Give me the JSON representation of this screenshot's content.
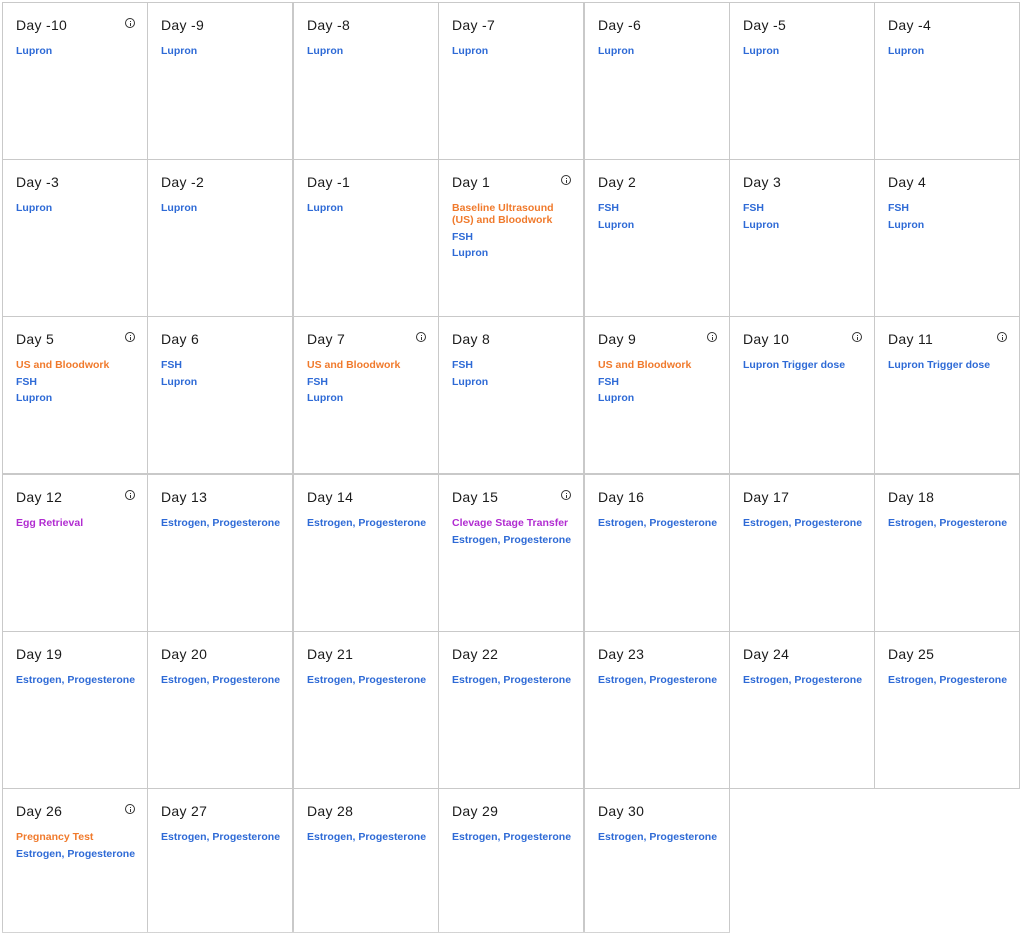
{
  "days": [
    {
      "label": "Day -10",
      "info": true,
      "events": [
        {
          "text": "Lupron",
          "color": "blue"
        }
      ]
    },
    {
      "label": "Day -9",
      "info": false,
      "events": [
        {
          "text": "Lupron",
          "color": "blue"
        }
      ]
    },
    {
      "label": "Day -8",
      "info": false,
      "events": [
        {
          "text": "Lupron",
          "color": "blue"
        }
      ]
    },
    {
      "label": "Day -7",
      "info": false,
      "events": [
        {
          "text": "Lupron",
          "color": "blue"
        }
      ]
    },
    {
      "label": "Day -6",
      "info": false,
      "events": [
        {
          "text": "Lupron",
          "color": "blue"
        }
      ]
    },
    {
      "label": "Day -5",
      "info": false,
      "events": [
        {
          "text": "Lupron",
          "color": "blue"
        }
      ]
    },
    {
      "label": "Day -4",
      "info": false,
      "events": [
        {
          "text": "Lupron",
          "color": "blue"
        }
      ]
    },
    {
      "label": "Day -3",
      "info": false,
      "events": [
        {
          "text": "Lupron",
          "color": "blue"
        }
      ]
    },
    {
      "label": "Day -2",
      "info": false,
      "events": [
        {
          "text": "Lupron",
          "color": "blue"
        }
      ]
    },
    {
      "label": "Day -1",
      "info": false,
      "events": [
        {
          "text": "Lupron",
          "color": "blue"
        }
      ]
    },
    {
      "label": "Day 1",
      "info": true,
      "events": [
        {
          "text": "Baseline Ultrasound (US) and Bloodwork",
          "color": "orange"
        },
        {
          "text": "FSH",
          "color": "blue"
        },
        {
          "text": "Lupron",
          "color": "blue"
        }
      ]
    },
    {
      "label": "Day 2",
      "info": false,
      "events": [
        {
          "text": "FSH",
          "color": "blue"
        },
        {
          "text": "Lupron",
          "color": "blue"
        }
      ]
    },
    {
      "label": "Day 3",
      "info": false,
      "events": [
        {
          "text": "FSH",
          "color": "blue"
        },
        {
          "text": "Lupron",
          "color": "blue"
        }
      ]
    },
    {
      "label": "Day 4",
      "info": false,
      "events": [
        {
          "text": "FSH",
          "color": "blue"
        },
        {
          "text": "Lupron",
          "color": "blue"
        }
      ]
    },
    {
      "label": "Day 5",
      "info": true,
      "events": [
        {
          "text": "US and Bloodwork",
          "color": "orange"
        },
        {
          "text": "FSH",
          "color": "blue"
        },
        {
          "text": "Lupron",
          "color": "blue"
        }
      ]
    },
    {
      "label": "Day 6",
      "info": false,
      "events": [
        {
          "text": "FSH",
          "color": "blue"
        },
        {
          "text": "Lupron",
          "color": "blue"
        }
      ]
    },
    {
      "label": "Day 7",
      "info": true,
      "events": [
        {
          "text": "US and Bloodwork",
          "color": "orange"
        },
        {
          "text": "FSH",
          "color": "blue"
        },
        {
          "text": "Lupron",
          "color": "blue"
        }
      ]
    },
    {
      "label": "Day 8",
      "info": false,
      "events": [
        {
          "text": "FSH",
          "color": "blue"
        },
        {
          "text": "Lupron",
          "color": "blue"
        }
      ]
    },
    {
      "label": "Day 9",
      "info": true,
      "events": [
        {
          "text": "US and Bloodwork",
          "color": "orange"
        },
        {
          "text": "FSH",
          "color": "blue"
        },
        {
          "text": "Lupron",
          "color": "blue"
        }
      ]
    },
    {
      "label": "Day 10",
      "info": true,
      "events": [
        {
          "text": "Lupron Trigger dose",
          "color": "blue"
        }
      ]
    },
    {
      "label": "Day 11",
      "info": true,
      "events": [
        {
          "text": "Lupron Trigger dose",
          "color": "blue"
        }
      ]
    },
    {
      "label": "Day 12",
      "info": true,
      "events": [
        {
          "text": "Egg Retrieval",
          "color": "purple"
        }
      ]
    },
    {
      "label": "Day 13",
      "info": false,
      "events": [
        {
          "text": "Estrogen, Progesterone",
          "color": "blue"
        }
      ]
    },
    {
      "label": "Day 14",
      "info": false,
      "events": [
        {
          "text": "Estrogen, Progesterone",
          "color": "blue"
        }
      ]
    },
    {
      "label": "Day 15",
      "info": true,
      "events": [
        {
          "text": "Clevage Stage Transfer",
          "color": "purple"
        },
        {
          "text": "Estrogen, Progesterone",
          "color": "blue"
        }
      ]
    },
    {
      "label": "Day 16",
      "info": false,
      "events": [
        {
          "text": "Estrogen, Progesterone",
          "color": "blue"
        }
      ]
    },
    {
      "label": "Day 17",
      "info": false,
      "events": [
        {
          "text": "Estrogen, Progesterone",
          "color": "blue"
        }
      ]
    },
    {
      "label": "Day 18",
      "info": false,
      "events": [
        {
          "text": "Estrogen, Progesterone",
          "color": "blue"
        }
      ]
    },
    {
      "label": "Day 19",
      "info": false,
      "events": [
        {
          "text": "Estrogen, Progesterone",
          "color": "blue"
        }
      ]
    },
    {
      "label": "Day 20",
      "info": false,
      "events": [
        {
          "text": "Estrogen, Progesterone",
          "color": "blue"
        }
      ]
    },
    {
      "label": "Day 21",
      "info": false,
      "events": [
        {
          "text": "Estrogen, Progesterone",
          "color": "blue"
        }
      ]
    },
    {
      "label": "Day 22",
      "info": false,
      "events": [
        {
          "text": "Estrogen, Progesterone",
          "color": "blue"
        }
      ]
    },
    {
      "label": "Day 23",
      "info": false,
      "events": [
        {
          "text": "Estrogen, Progesterone",
          "color": "blue"
        }
      ]
    },
    {
      "label": "Day 24",
      "info": false,
      "events": [
        {
          "text": "Estrogen, Progesterone",
          "color": "blue"
        }
      ]
    },
    {
      "label": "Day 25",
      "info": false,
      "events": [
        {
          "text": "Estrogen, Progesterone",
          "color": "blue"
        }
      ]
    },
    {
      "label": "Day 26",
      "info": true,
      "events": [
        {
          "text": "Pregnancy Test",
          "color": "orange"
        },
        {
          "text": "Estrogen, Progesterone",
          "color": "blue"
        }
      ]
    },
    {
      "label": "Day 27",
      "info": false,
      "events": [
        {
          "text": "Estrogen, Progesterone",
          "color": "blue"
        }
      ]
    },
    {
      "label": "Day 28",
      "info": false,
      "events": [
        {
          "text": "Estrogen, Progesterone",
          "color": "blue"
        }
      ]
    },
    {
      "label": "Day 29",
      "info": false,
      "events": [
        {
          "text": "Estrogen, Progesterone",
          "color": "blue"
        }
      ]
    },
    {
      "label": "Day 30",
      "info": false,
      "events": [
        {
          "text": "Estrogen, Progesterone",
          "color": "blue"
        }
      ]
    }
  ],
  "colors": {
    "blue": "#2e6ad6",
    "orange": "#f07a2c",
    "purple": "#b12cd1"
  }
}
